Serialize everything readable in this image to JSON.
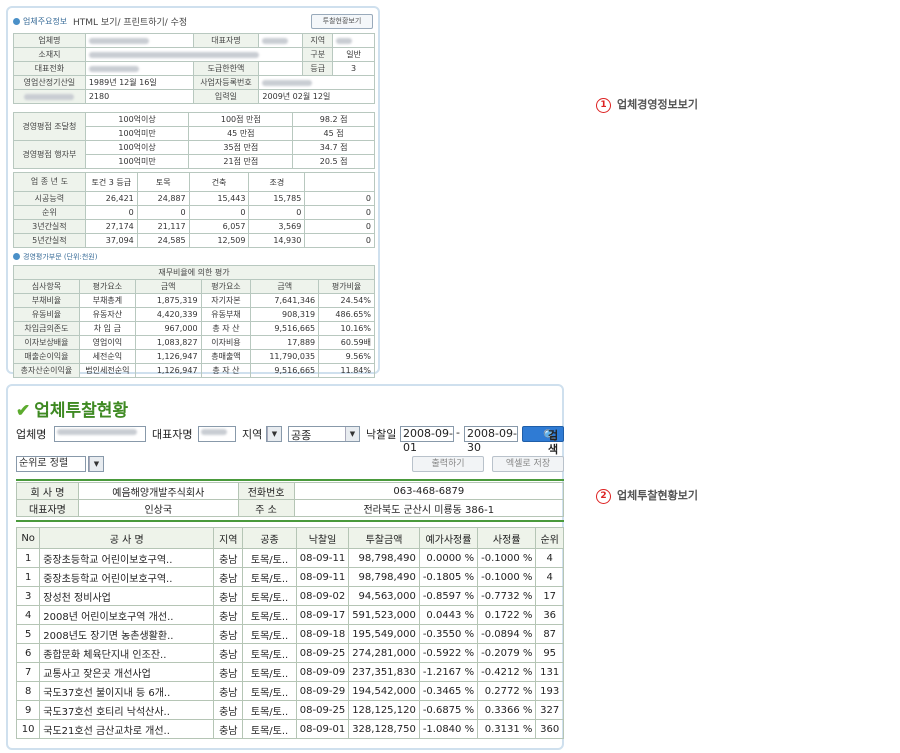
{
  "panel1": {
    "section_title": "업체주요정보",
    "links": "HTML 보기/  프린트하기/ 수정",
    "top_button": "투찰현황보기",
    "info": {
      "company_label": "업체명",
      "rep_label": "대표자명",
      "region_label": "지역",
      "address_label": "소재지",
      "category_label": "구분",
      "category_value": "일반",
      "phone_label": "대표전화",
      "sub_label": "도급한한액",
      "grade_label": "등급",
      "grade_value": "3",
      "start_label": "영업산정기산일",
      "start_value": "1989년 12월 16일",
      "bizno_label": "사업자등록번호",
      "regno_value": "2180",
      "input_label": "입력일",
      "input_value": "2009년 02월 12일"
    },
    "eval": {
      "row1_label": "경영평점\n조달청",
      "row2_label": "경영평점\n행자부",
      "rows": [
        [
          "100억이상",
          "100점 만점",
          "98.2 점"
        ],
        [
          "100억미만",
          "45 만점",
          "45 점"
        ],
        [
          "100억이상",
          "35점 만점",
          "34.7 점"
        ],
        [
          "100억미만",
          "21점 만점",
          "20.5 점"
        ]
      ]
    },
    "perf": {
      "head": [
        "업 종\n년 도",
        "토건 3 등급",
        "토목",
        "건축",
        "조경",
        ""
      ],
      "rows": [
        [
          "시공능력",
          "26,421",
          "24,887",
          "15,443",
          "15,785",
          "0"
        ],
        [
          "순위",
          "0",
          "0",
          "0",
          "0",
          "0"
        ],
        [
          "3년간실적",
          "27,174",
          "21,117",
          "6,057",
          "3,569",
          "0"
        ],
        [
          "5년간실적",
          "37,094",
          "24,585",
          "12,509",
          "14,930",
          "0"
        ]
      ]
    },
    "section2_title": "경영평가부문 (단위:천원)",
    "fin": {
      "caption": "재무비율에 의한 평가",
      "head": [
        "심사항목",
        "평가요소",
        "금액",
        "평가요소",
        "금액",
        "평가비율"
      ],
      "rows": [
        [
          "부채비율",
          "부채총계",
          "1,875,319",
          "자기자본",
          "7,641,346",
          "24.54%"
        ],
        [
          "유동비율",
          "유동자산",
          "4,420,339",
          "유동부채",
          "908,319",
          "486.65%"
        ],
        [
          "차입금의존도",
          "차 입 금",
          "967,000",
          "총 자 산",
          "9,516,665",
          "10.16%"
        ],
        [
          "이자보상배율",
          "영업이익",
          "1,083,827",
          "이자비용",
          "17,889",
          "60.59배"
        ],
        [
          "매출순이익율",
          "세전순익",
          "1,126,947",
          "총매출액",
          "11,790,035",
          "9.56%"
        ],
        [
          "총자산순이익율",
          "법인세전순익",
          "1,126,947",
          "총 자 산",
          "9,516,665",
          "11.84%"
        ]
      ]
    }
  },
  "panel2": {
    "title": "업체투찰현황",
    "search": {
      "company_label": "업체명",
      "rep_label": "대표자명",
      "region_label": "지역",
      "type_value": "공종",
      "date_label": "낙찰일",
      "date_from": "2008-09-01",
      "date_sep": "-",
      "date_to": "2008-09-30",
      "search_button": "검색"
    },
    "sort_value": "순위로 정렬",
    "print_button": "출력하기",
    "excel_button": "엑셀로 저장",
    "info": {
      "company_label": "회 사 명",
      "company_value": "예음해양개발주식회사",
      "phone_label": "전화번호",
      "phone_value": "063-468-6879",
      "rep_label": "대표자명",
      "rep_value": "인상국",
      "addr_label": "주 소",
      "addr_value": "전라북도 군산시 미룡동 386-1"
    },
    "table": {
      "head": [
        "No",
        "공 사 명",
        "지역",
        "공종",
        "낙찰일",
        "투찰금액",
        "예가사정률",
        "사정률",
        "순위"
      ],
      "rows": [
        [
          "1",
          "중장초등학교 어린이보호구역..",
          "충남",
          "토목/토..",
          "08-09-11",
          "98,798,490",
          "0.0000 %",
          "-0.1000 %",
          "4"
        ],
        [
          "1",
          "중장초등학교 어린이보호구역..",
          "충남",
          "토목/토..",
          "08-09-11",
          "98,798,490",
          "-0.1805 %",
          "-0.1000 %",
          "4"
        ],
        [
          "3",
          "장성천 정비사업",
          "충남",
          "토목/토..",
          "08-09-02",
          "94,563,000",
          "-0.8597 %",
          "-0.7732 %",
          "17"
        ],
        [
          "4",
          "2008년 어린이보호구역 개선..",
          "충남",
          "토목/토..",
          "08-09-17",
          "591,523,000",
          "0.0443 %",
          "0.1722 %",
          "36"
        ],
        [
          "5",
          "2008년도 장기면 농촌생활환..",
          "충남",
          "토목/토..",
          "08-09-18",
          "195,549,000",
          "-0.3550 %",
          "-0.0894 %",
          "87"
        ],
        [
          "6",
          "종합문화 체육단지내 인조잔..",
          "충남",
          "토목/토..",
          "08-09-25",
          "274,281,000",
          "-0.5922 %",
          "-0.2079 %",
          "95"
        ],
        [
          "7",
          "교통사고 잦은곳 개선사업",
          "충남",
          "토목/토..",
          "08-09-09",
          "237,351,830",
          "-1.2167 %",
          "-0.4212 %",
          "131"
        ],
        [
          "8",
          "국도37호선 불이지내 등 6개..",
          "충남",
          "토목/토..",
          "08-09-29",
          "194,542,000",
          "-0.3465 %",
          "0.2772 %",
          "193"
        ],
        [
          "9",
          "국도37호선 호티리 낙석산사..",
          "충남",
          "토목/토..",
          "08-09-25",
          "128,125,120",
          "-0.6875 %",
          "0.3366 %",
          "327"
        ],
        [
          "10",
          "국도21호선 금산교차로 개선..",
          "충남",
          "토목/토..",
          "08-09-01",
          "328,128,750",
          "-1.0840 %",
          "0.3131 %",
          "360"
        ]
      ]
    }
  },
  "annotations": [
    {
      "num": "1",
      "label": "업체경영정보보기"
    },
    {
      "num": "2",
      "label": "업체투찰현황보기"
    }
  ]
}
